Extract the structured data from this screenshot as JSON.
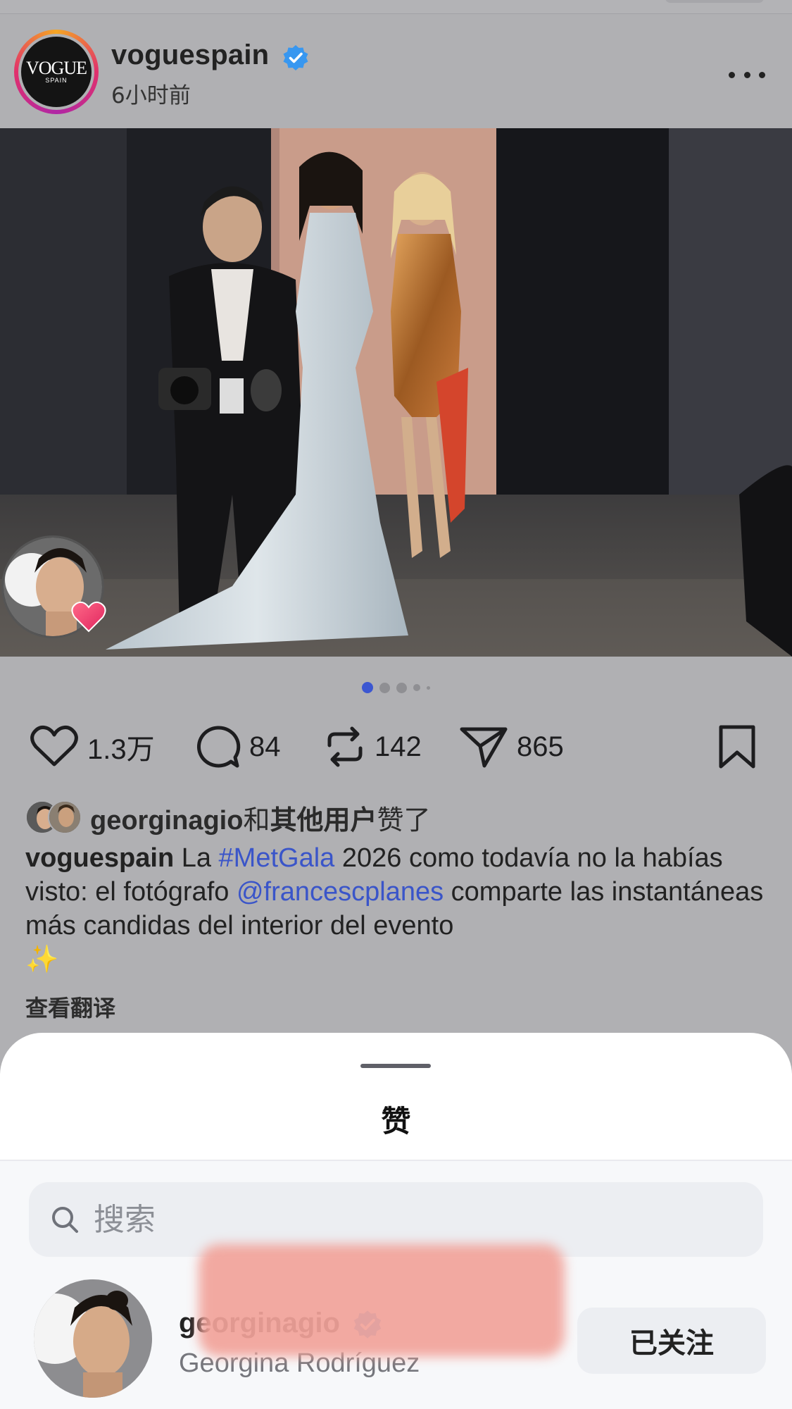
{
  "post": {
    "username": "voguespain",
    "time_ago": "6小时前",
    "avatar_logo_text": "VOGUE",
    "avatar_logo_sub": "SPAIN",
    "carousel_total": 5,
    "carousel_active": 1
  },
  "actions": {
    "likes": "1.3万",
    "comments": "84",
    "reposts": "142",
    "shares": "865"
  },
  "liked_by": {
    "user": "georginagio",
    "connector": "和",
    "others": "其他用户",
    "suffix": "赞了"
  },
  "caption": {
    "user": "voguespain",
    "text_1": " La ",
    "hashtag": "#MetGala",
    "text_2": " 2026 como todavía no la habías visto: el fotógrafo ",
    "mention": "@francescplanes",
    "text_3": " comparte las instantáneas más candidas del interior del evento ",
    "emoji": "✨",
    "translate_label": "查看翻译"
  },
  "sheet": {
    "title": "赞",
    "search_placeholder": "搜索",
    "users": [
      {
        "username": "georginagio",
        "full_name": "Georgina Rodríguez",
        "follow_label": "已关注"
      }
    ]
  },
  "colors": {
    "verified": "#3897f0",
    "link": "#3a55c9",
    "carousel_active": "#3c57d1"
  }
}
